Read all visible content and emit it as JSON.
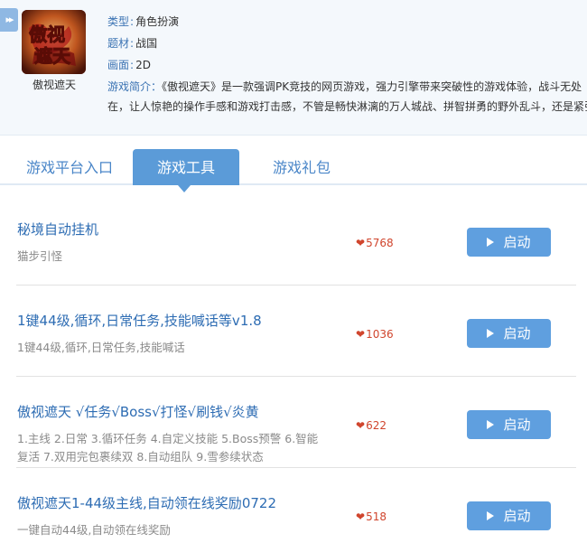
{
  "game": {
    "name": "傲视遮天",
    "cover_text": "傲视遮天",
    "type_label": "类型",
    "type_value": "角色扮演",
    "theme_label": "题材",
    "theme_value": "战国",
    "graphics_label": "画面",
    "graphics_value": "2D",
    "intro_label": "游戏简介：",
    "intro_line1": "《傲视遮天》是一款强调PK竞技的网页游戏，强力引擎带来突破性的游戏体验，战斗无处",
    "intro_line2": "在，让人惊艳的操作手感和游戏打击感，不管是畅快淋漓的万人城战、拼智拼勇的野外乱斗，还是紧张"
  },
  "tabs": [
    {
      "label": "游戏平台入口"
    },
    {
      "label": "游戏工具"
    },
    {
      "label": "游戏礼包"
    }
  ],
  "tools": [
    {
      "title": "秘境自动挂机",
      "desc": "猫步引怪",
      "likes": "5768",
      "button": "启动"
    },
    {
      "title": "1键44级,循环,日常任务,技能喊话等v1.8",
      "desc": "1键44级,循环,日常任务,技能喊话",
      "likes": "1036",
      "button": "启动"
    },
    {
      "title": "傲视遮天 √任务√Boss√打怪√刷钱√炎黄",
      "desc": "1.主线 2.日常 3.循环任务 4.自定义技能 5.Boss预警 6.智能复活 7.双用完包裹续双 8.自动组队 9.雪参续状态",
      "likes": "622",
      "button": "启动"
    },
    {
      "title": "傲视遮天1-44级主线,自动领在线奖励0722",
      "desc": "一键自动44级,自动领在线奖励",
      "likes": "518",
      "button": "启动"
    }
  ],
  "colors": {
    "accent": "#5b9bd8",
    "link": "#2d6cb3",
    "like": "#d0452d"
  }
}
